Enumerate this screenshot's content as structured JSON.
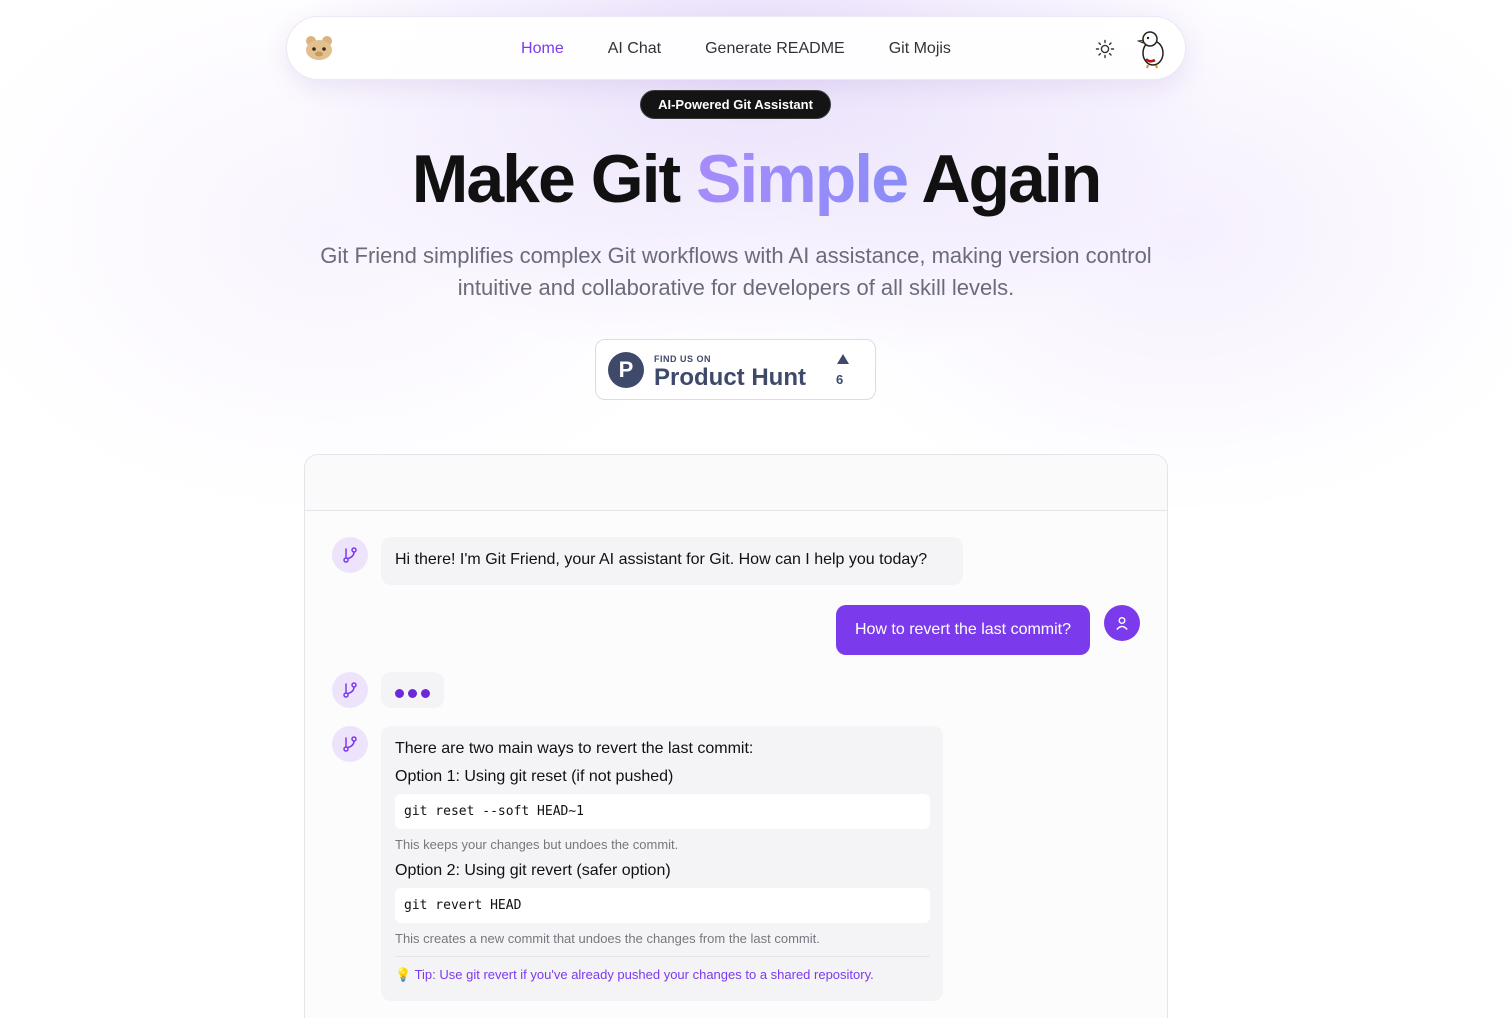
{
  "nav": {
    "links": [
      {
        "label": "Home",
        "active": true
      },
      {
        "label": "AI Chat",
        "active": false
      },
      {
        "label": "Generate README",
        "active": false
      },
      {
        "label": "Git Mojis",
        "active": false
      }
    ],
    "logo_icon": "bear-logo-icon",
    "theme_icon": "sun-icon",
    "profile_icon": "duck-avatar-icon"
  },
  "badge": "AI-Powered Git Assistant",
  "hero": {
    "title_pre": "Make Git ",
    "title_accent": "Simple",
    "title_post": " Again",
    "subtitle": "Git Friend simplifies complex Git workflows with AI assistance, making version control intuitive and collaborative for developers of all skill levels."
  },
  "product_hunt": {
    "small": "FIND US ON",
    "big": "Product Hunt",
    "logo_letter": "P",
    "upvotes": "6"
  },
  "chat": {
    "greeting": "Hi there! I'm Git Friend, your AI assistant for Git. How can I help you today?",
    "user_question": "How to revert the last commit?",
    "response": {
      "intro": "There are two main ways to revert the last commit:",
      "option1_title": "Option 1: Using git reset (if not pushed)",
      "option1_code": "git reset --soft HEAD~1",
      "option1_note": "This keeps your changes but undoes the commit.",
      "option2_title": "Option 2: Using git revert (safer option)",
      "option2_code": "git revert HEAD",
      "option2_note": "This creates a new commit that undoes the changes from the last commit.",
      "tip_icon": "💡",
      "tip": "Tip: Use git revert if you've already pushed your changes to a shared repository."
    }
  },
  "colors": {
    "accent": "#7c3aed",
    "accent_light": "#a78bfa",
    "bot_avatar_bg": "#ede4fc",
    "ph_brand": "#3f4a6b"
  }
}
